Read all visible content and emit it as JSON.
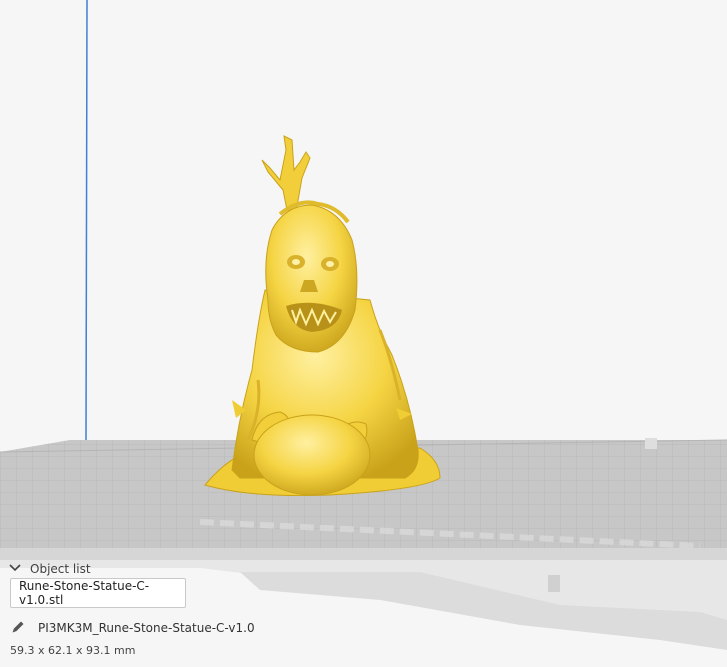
{
  "object_panel": {
    "header_label": "Object list",
    "object_name": "Rune-Stone-Statue-C-v1.0.stl",
    "job_name": "PI3MK3M_Rune-Stone-Statue-C-v1.0",
    "dimensions": "59.3 x 62.1 x 93.1 mm"
  },
  "icons": {
    "collapse": "chevron-down-icon",
    "edit": "pencil-icon"
  },
  "colors": {
    "model": "#f5d443",
    "build_plate": "#c4c4c4",
    "z_axis": "#3f7fd6",
    "background": "#f6f6f6"
  }
}
